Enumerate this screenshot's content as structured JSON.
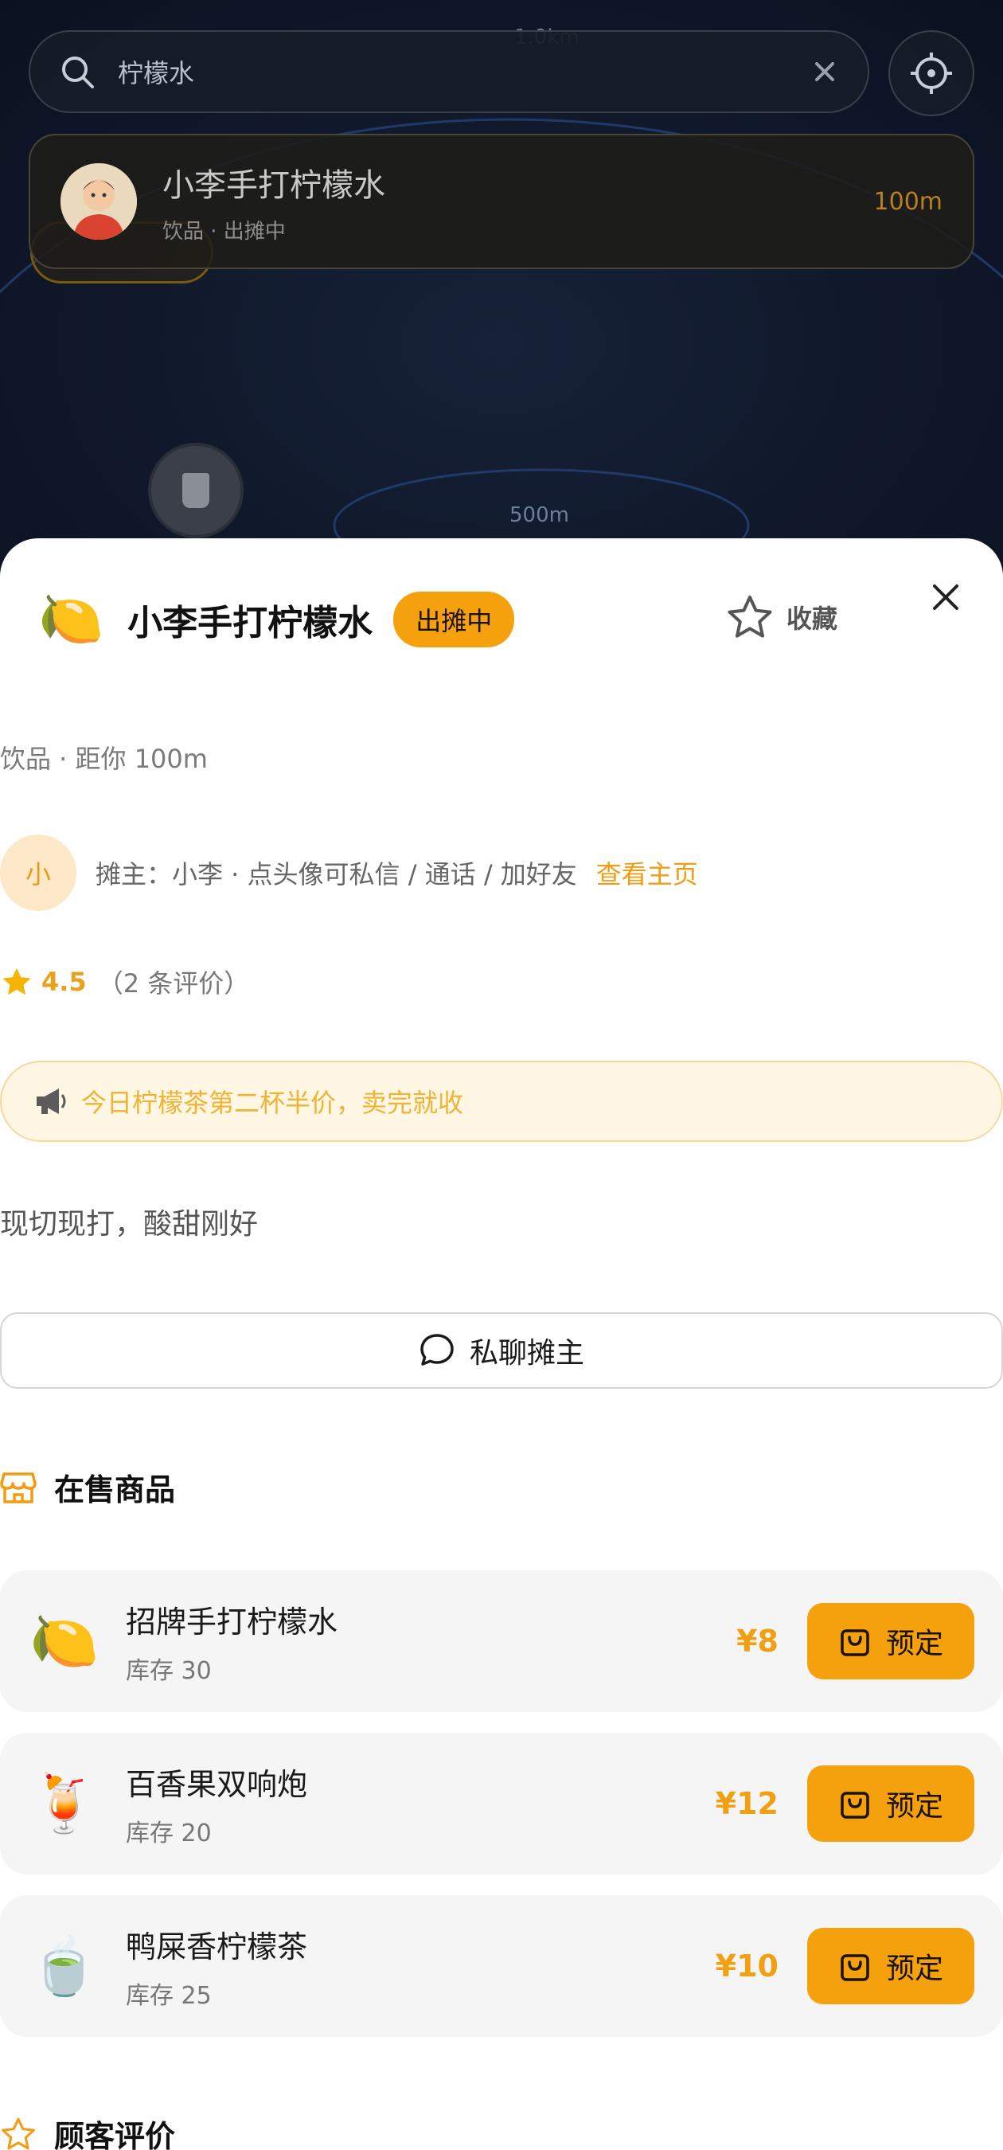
{
  "map": {
    "label_top": "1.0km",
    "label_bottom": "500m"
  },
  "search": {
    "query": "柠檬水"
  },
  "result": {
    "name": "小李手打柠檬水",
    "subtitle": "饮品 · 出摊中",
    "distance": "100m"
  },
  "sheet": {
    "emoji": "🍋",
    "title": "小李手打柠檬水",
    "status_badge": "出摊中",
    "favorite_label": "收藏",
    "meta": "饮品 · 距你 100m",
    "owner_initial": "小",
    "owner_text": "摊主：小李 · 点头像可私信 / 通话 / 加好友",
    "owner_link": "查看主页",
    "rating": "4.5",
    "rating_count": "（2 条评价）",
    "notice": "今日柠檬茶第二杯半价，卖完就收",
    "description": "现切现打，酸甜刚好",
    "chat_button": "私聊摊主",
    "products_title": "在售商品",
    "reviews_title": "顾客评价",
    "products": [
      {
        "emoji": "🍋",
        "name": "招牌手打柠檬水",
        "stock": "库存 30",
        "price": "¥8",
        "action": "预定"
      },
      {
        "emoji": "🍹",
        "name": "百香果双响炮",
        "stock": "库存 20",
        "price": "¥12",
        "action": "预定"
      },
      {
        "emoji": "🍵",
        "name": "鸭屎香柠檬茶",
        "stock": "库存 25",
        "price": "¥10",
        "action": "预定"
      }
    ]
  },
  "colors": {
    "accent": "#f5a10e",
    "map_bg": "#0f1729"
  }
}
